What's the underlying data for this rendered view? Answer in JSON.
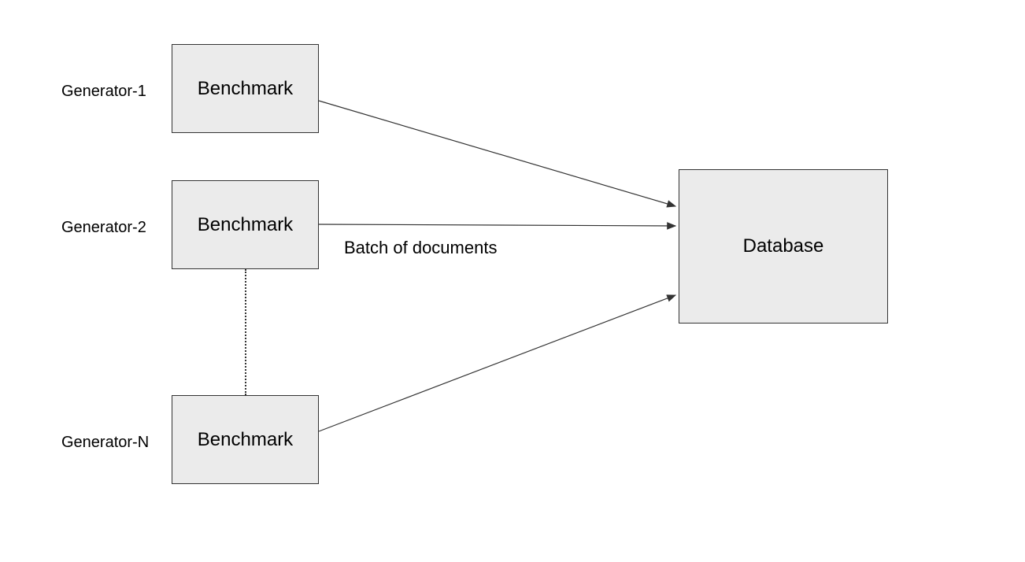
{
  "generators": [
    {
      "label": "Generator-1",
      "box_label": "Benchmark"
    },
    {
      "label": "Generator-2",
      "box_label": "Benchmark"
    },
    {
      "label": "Generator-N",
      "box_label": "Benchmark"
    }
  ],
  "target": {
    "box_label": "Database"
  },
  "edge_label": "Batch of documents"
}
